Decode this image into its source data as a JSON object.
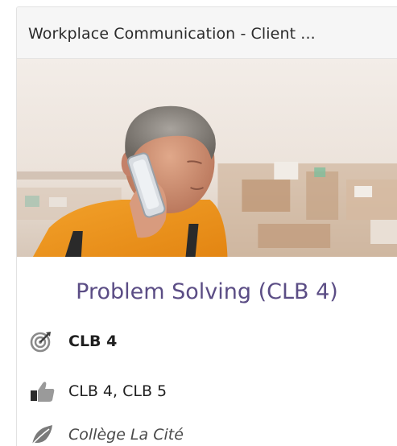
{
  "card": {
    "header_title": "Workplace Communication - Client ...",
    "course_title": "Problem Solving (CLB 4)",
    "level": "CLB 4",
    "recommended_levels": "CLB 4, CLB 5",
    "provider": "Collège La Cité",
    "icons": {
      "level": "target-icon",
      "recommended": "thumbs-up-icon",
      "provider": "leaf-icon"
    }
  },
  "colors": {
    "course_title": "#5b4d85",
    "icon_gray": "#7a7a7a",
    "header_bg": "#f6f6f6"
  }
}
